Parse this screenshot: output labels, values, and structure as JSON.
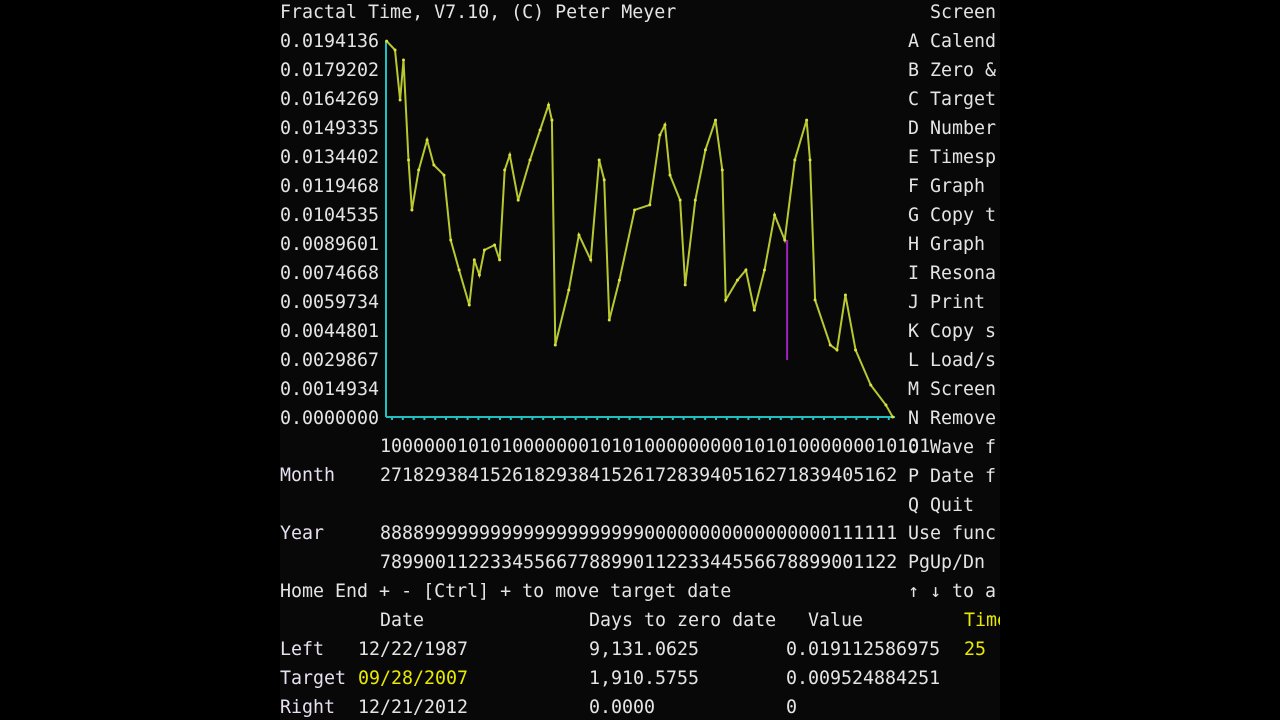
{
  "title": "Fractal Time, V7.10, (C) Peter Meyer",
  "menu": {
    "header": "Screen",
    "items": [
      {
        "key": "A",
        "label": "Calend"
      },
      {
        "key": "B",
        "label": "Zero &"
      },
      {
        "key": "C",
        "label": "Target"
      },
      {
        "key": "D",
        "label": "Number"
      },
      {
        "key": "E",
        "label": "Timesp"
      },
      {
        "key": "F",
        "label": "Graph"
      },
      {
        "key": "G",
        "label": "Copy t"
      },
      {
        "key": "H",
        "label": "Graph"
      },
      {
        "key": "I",
        "label": "Resona"
      },
      {
        "key": "J",
        "label": "Print"
      },
      {
        "key": "K",
        "label": "Copy s"
      },
      {
        "key": "L",
        "label": "Load/s"
      },
      {
        "key": "M",
        "label": "Screen"
      },
      {
        "key": "N",
        "label": "Remove"
      },
      {
        "key": "O",
        "label": "Wave f"
      },
      {
        "key": "P",
        "label": "Date f"
      },
      {
        "key": "Q",
        "label": "Quit"
      }
    ],
    "hint1": "Use func",
    "hint2": "PgUp/Dn :",
    "hint3": "↑ ↓ to a"
  },
  "axis": {
    "decade_row": "10000001010100000001010100000000010101000000010101",
    "month_label": "Month",
    "month_row": "27182938415261829384152617283940516271839405162",
    "year_label": "Year",
    "year_row1": "88889999999999999999999900000000000000000111111",
    "year_row2": "78990011223345566778899011223344556678899001122"
  },
  "help": "Home End + - [Ctrl] + to move target date",
  "table": {
    "headers": {
      "date": "Date",
      "days": "Days to zero date",
      "value": "Value",
      "time": "Time"
    },
    "rows": [
      {
        "label": "Left",
        "date": "12/22/1987",
        "days": "9,131.0625",
        "value": "0.019112586975",
        "time": "25"
      },
      {
        "label": "Target",
        "date": "09/28/2007",
        "days": "1,910.5755",
        "value": "0.009524884251"
      },
      {
        "label": "Right",
        "date": "12/21/2012",
        "days": "0.0000",
        "value": "0"
      }
    ]
  },
  "colors": {
    "line": "#b8c830",
    "axis": "#20c0c0",
    "target_marker": "#a020c0",
    "highlight": "#e8e800"
  },
  "chart_data": {
    "type": "line",
    "ylim": [
      0,
      0.0194136
    ],
    "xlim": [
      "1987-12-22",
      "2012-12-21"
    ],
    "ytick_labels": [
      "0.0194136",
      "0.0179202",
      "0.0164269",
      "0.0149335",
      "0.0134402",
      "0.0119468",
      "0.0104535",
      "0.0089601",
      "0.0074668",
      "0.0059734",
      "0.0044801",
      "0.0029867",
      "0.0014934",
      "0.0000000"
    ],
    "target_date": "2007-09-28",
    "points": [
      [
        "1987-12",
        0.01941
      ],
      [
        "1988-05",
        0.01895
      ],
      [
        "1988-08",
        0.01637
      ],
      [
        "1988-10",
        0.01843
      ],
      [
        "1989-01",
        0.01327
      ],
      [
        "1989-03",
        0.01069
      ],
      [
        "1989-07",
        0.01275
      ],
      [
        "1989-12",
        0.0143
      ],
      [
        "1990-04",
        0.01301
      ],
      [
        "1990-10",
        0.01249
      ],
      [
        "1991-02",
        0.00914
      ],
      [
        "1991-07",
        0.00759
      ],
      [
        "1992-01",
        0.00578
      ],
      [
        "1992-04",
        0.00811
      ],
      [
        "1992-07",
        0.00733
      ],
      [
        "1992-10",
        0.00862
      ],
      [
        "1993-04",
        0.00888
      ],
      [
        "1993-07",
        0.00811
      ],
      [
        "1993-10",
        0.01275
      ],
      [
        "1994-01",
        0.01353
      ],
      [
        "1994-06",
        0.0112
      ],
      [
        "1995-01",
        0.01327
      ],
      [
        "1995-07",
        0.01482
      ],
      [
        "1995-12",
        0.01611
      ],
      [
        "1996-02",
        0.01533
      ],
      [
        "1996-04",
        0.00372
      ],
      [
        "1996-12",
        0.00656
      ],
      [
        "1997-06",
        0.0094
      ],
      [
        "1998-01",
        0.00811
      ],
      [
        "1998-06",
        0.01327
      ],
      [
        "1998-09",
        0.01224
      ],
      [
        "1998-12",
        0.00501
      ],
      [
        "1999-06",
        0.00707
      ],
      [
        "2000-03",
        0.01069
      ],
      [
        "2000-12",
        0.01095
      ],
      [
        "2001-06",
        0.01456
      ],
      [
        "2001-09",
        0.01508
      ],
      [
        "2001-12",
        0.01249
      ],
      [
        "2002-06",
        0.0112
      ],
      [
        "2002-09",
        0.00682
      ],
      [
        "2003-03",
        0.0112
      ],
      [
        "2003-09",
        0.01379
      ],
      [
        "2004-03",
        0.01533
      ],
      [
        "2004-07",
        0.01275
      ],
      [
        "2004-09",
        0.00604
      ],
      [
        "2005-04",
        0.00707
      ],
      [
        "2005-09",
        0.00759
      ],
      [
        "2006-02",
        0.00552
      ],
      [
        "2006-08",
        0.00759
      ],
      [
        "2007-02",
        0.01043
      ],
      [
        "2007-08",
        0.00914
      ],
      [
        "2008-02",
        0.01327
      ],
      [
        "2008-09",
        0.01533
      ],
      [
        "2008-11",
        0.01327
      ],
      [
        "2009-02",
        0.00604
      ],
      [
        "2009-11",
        0.00372
      ],
      [
        "2010-03",
        0.00346
      ],
      [
        "2010-08",
        0.0063
      ],
      [
        "2011-02",
        0.00346
      ],
      [
        "2011-11",
        0.00165
      ],
      [
        "2012-08",
        0.00062
      ],
      [
        "2012-12",
        0.0
      ]
    ]
  }
}
